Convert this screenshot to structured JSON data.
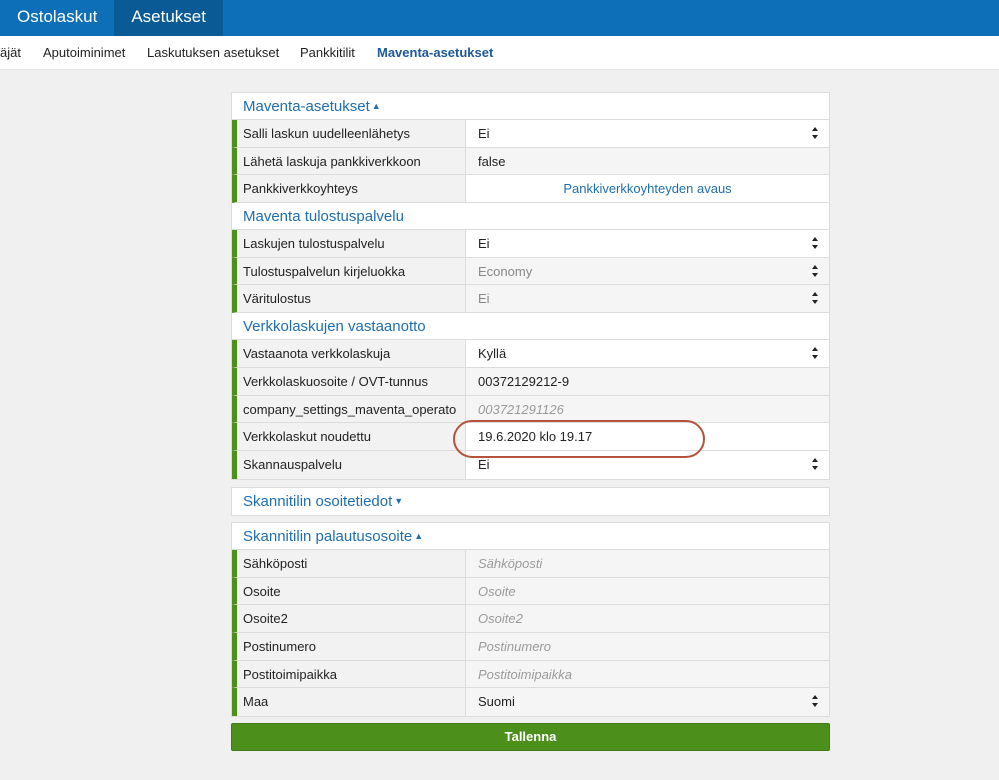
{
  "topnav": {
    "tabs": [
      {
        "label": "Ostolaskut"
      },
      {
        "label": "Asetukset"
      }
    ]
  },
  "subnav": {
    "items": [
      {
        "label": "äjät"
      },
      {
        "label": "Aputoiminimet"
      },
      {
        "label": "Laskutuksen asetukset"
      },
      {
        "label": "Pankkitilit"
      },
      {
        "label": "Maventa-asetukset"
      }
    ]
  },
  "sections": [
    {
      "title": "Maventa-asetukset",
      "rows": [
        {
          "label": "Salli laskun uudelleenlähetys",
          "value": "Ei"
        },
        {
          "label": "Lähetä laskuja pankkiverkkoon",
          "value": "false"
        },
        {
          "label": "Pankkiverkkoyhteys",
          "value": "Pankkiverkkoyhteyden avaus"
        }
      ]
    },
    {
      "title": "Maventa tulostuspalvelu",
      "rows": [
        {
          "label": "Laskujen tulostuspalvelu",
          "value": "Ei"
        },
        {
          "label": "Tulostuspalvelun kirjeluokka",
          "value": "Economy"
        },
        {
          "label": "Väritulostus",
          "value": "Ei"
        }
      ]
    },
    {
      "title": "Verkkolaskujen vastaanotto",
      "rows": [
        {
          "label": "Vastaanota verkkolaskuja",
          "value": "Kyllä"
        },
        {
          "label": "Verkkolaskuosoite / OVT-tunnus",
          "value": "00372129212-9"
        },
        {
          "label": "company_settings_maventa_operato",
          "value": "003721291126"
        },
        {
          "label": "Verkkolaskut noudettu",
          "value": "19.6.2020 klo 19.17"
        },
        {
          "label": "Skannauspalvelu",
          "value": "Ei"
        }
      ]
    },
    {
      "title": "Skannitilin osoitetiedot",
      "rows": []
    },
    {
      "title": "Skannitilin palautusosoite",
      "rows": [
        {
          "label": "Sähköposti",
          "placeholder": "Sähköposti"
        },
        {
          "label": "Osoite",
          "placeholder": "Osoite"
        },
        {
          "label": "Osoite2",
          "placeholder": "Osoite2"
        },
        {
          "label": "Postinumero",
          "placeholder": "Postinumero"
        },
        {
          "label": "Postitoimipaikka",
          "placeholder": "Postitoimipaikka"
        },
        {
          "label": "Maa",
          "value": "Suomi"
        }
      ]
    }
  ],
  "save_button": {
    "label": "Tallenna"
  },
  "colors": {
    "topbar": "#0c6fb7",
    "accent": "#1e6fb0",
    "green": "#4c8f1b",
    "highlight": "#b5533a"
  }
}
